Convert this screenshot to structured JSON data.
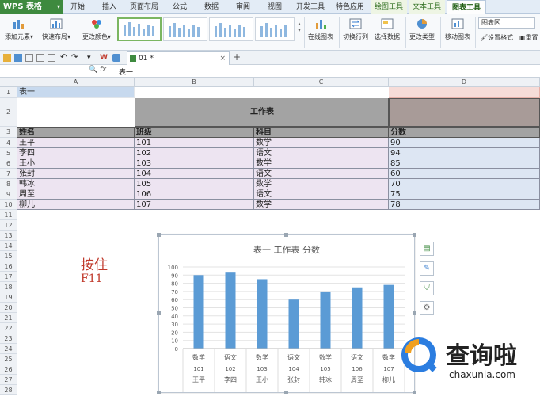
{
  "menubar": {
    "logo": "WPS 表格",
    "tabs": [
      "开始",
      "插入",
      "页面布局",
      "公式",
      "数据",
      "审阅",
      "视图",
      "开发工具",
      "特色应用"
    ],
    "context_tabs": [
      "绘图工具",
      "文本工具"
    ],
    "active_tab": "图表工具"
  },
  "ribbon": {
    "add_element": "添加元素",
    "quick_layout": "快速布局",
    "change_color": "更改颜色",
    "online_chart": "在线图表",
    "switch_row_col": "切换行列",
    "select_data": "选择数据",
    "change_type": "更改类型",
    "move_chart": "移动图表",
    "format": "设置格式",
    "reset": "重置",
    "chart_area": "图表区"
  },
  "toolbar2": {
    "doc_tab": "01 *"
  },
  "formula": {
    "fx": "fx",
    "value": "表一"
  },
  "columns": [
    "A",
    "B",
    "C",
    "D"
  ],
  "rows": [
    "1",
    "2",
    "3",
    "4",
    "5",
    "6",
    "7",
    "8",
    "9",
    "10",
    "11",
    "12",
    "13",
    "14",
    "15",
    "16",
    "17",
    "18",
    "19",
    "20",
    "21",
    "22",
    "23",
    "24",
    "25",
    "26",
    "27",
    "28"
  ],
  "sheet": {
    "a1": "表一",
    "title": "工作表",
    "headers": [
      "姓名",
      "班级",
      "科目",
      "分数"
    ],
    "data": [
      [
        "王平",
        "101",
        "数学",
        "90"
      ],
      [
        "李四",
        "102",
        "语文",
        "94"
      ],
      [
        "王小",
        "103",
        "数学",
        "85"
      ],
      [
        "张封",
        "104",
        "语文",
        "60"
      ],
      [
        "韩冰",
        "105",
        "数学",
        "70"
      ],
      [
        "周至",
        "106",
        "语文",
        "75"
      ],
      [
        "柳儿",
        "107",
        "数学",
        "78"
      ]
    ]
  },
  "hint": {
    "line1": "按住",
    "line2": "F11"
  },
  "chart_data": {
    "type": "bar",
    "title": "表一 工作表 分数",
    "categories": [
      [
        "数学",
        "101",
        "王平"
      ],
      [
        "语文",
        "102",
        "李四"
      ],
      [
        "数学",
        "103",
        "王小"
      ],
      [
        "语文",
        "104",
        "张封"
      ],
      [
        "数学",
        "105",
        "韩冰"
      ],
      [
        "语文",
        "106",
        "周至"
      ],
      [
        "数学",
        "107",
        "柳儿"
      ]
    ],
    "values": [
      90,
      94,
      85,
      60,
      70,
      75,
      78
    ],
    "ylim": [
      0,
      100
    ],
    "yticks": [
      0,
      10,
      20,
      30,
      40,
      50,
      60,
      70,
      80,
      90,
      100
    ],
    "color": "#5b9bd5",
    "grid": true
  },
  "watermark": {
    "brand": "查询啦",
    "url": "chaxunla.com"
  }
}
